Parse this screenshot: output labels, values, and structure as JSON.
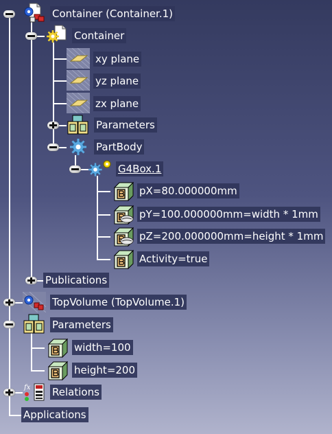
{
  "tree": {
    "root": {
      "label": "Container (Container.1)",
      "icon": "container-product-icon",
      "children": {
        "container": {
          "label": "Container",
          "icon": "part-document-icon",
          "xy_plane": "xy plane",
          "yz_plane": "yz plane",
          "zx_plane": "zx plane",
          "parameters": "Parameters",
          "partbody": {
            "label": "PartBody",
            "g4box": {
              "label": "G4Box.1",
              "params": [
                "pX=80.000000mm",
                "pY=100.000000mm=width * 1mm",
                "pZ=200.000000mm=height * 1mm",
                "Activity=true"
              ]
            }
          }
        },
        "publications": "Publications"
      }
    },
    "topvolume": "TopVolume (TopVolume.1)",
    "parameters": {
      "label": "Parameters",
      "items": [
        "width=100",
        "height=200"
      ]
    },
    "relations": "Relations",
    "applications": "Applications"
  },
  "colors": {
    "background_top": "#343a5f",
    "background_bottom": "#b0b3cc",
    "label_bg": "#30355a",
    "tree_line": "#ffffff"
  }
}
